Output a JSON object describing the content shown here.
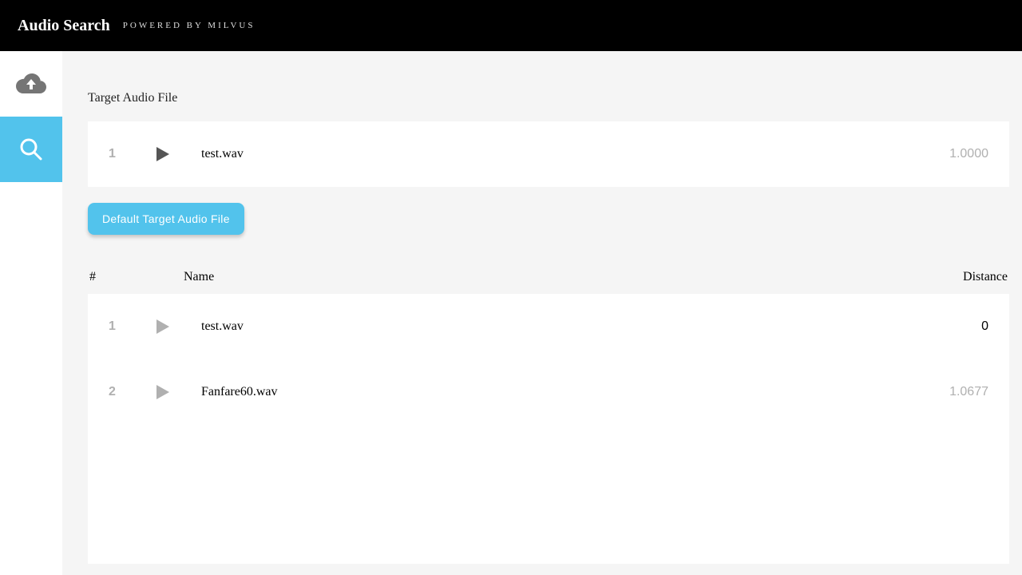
{
  "header": {
    "title": "Audio Search",
    "subtitle": "POWERED BY MILVUS"
  },
  "section": {
    "target_label": "Target Audio File"
  },
  "target": {
    "index": "1",
    "name": "test.wav",
    "distance": "1.0000"
  },
  "buttons": {
    "default_target": "Default Target Audio File"
  },
  "columns": {
    "index": "#",
    "name": "Name",
    "distance": "Distance"
  },
  "results": [
    {
      "index": "1",
      "name": "test.wav",
      "distance": "0",
      "black": true
    },
    {
      "index": "2",
      "name": "Fanfare60.wav",
      "distance": "1.0677",
      "black": false
    }
  ]
}
